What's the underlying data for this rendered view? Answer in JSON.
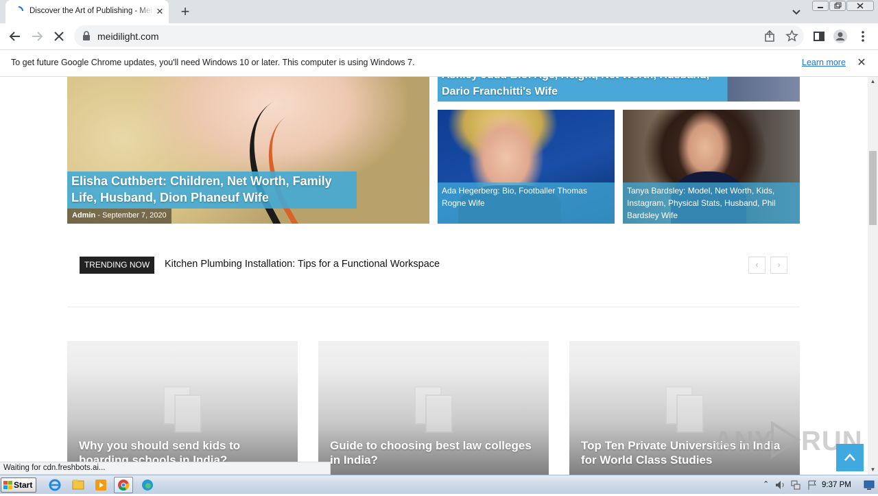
{
  "browser": {
    "tab_title": "Discover the Art of Publishing - Meidilight",
    "url": "meidilight.com",
    "infobar_message": "To get future Google Chrome updates, you'll need Windows 10 or later. This computer is using Windows 7.",
    "infobar_link": "Learn more",
    "status_text": "Waiting for cdn.freshbots.ai..."
  },
  "hero": {
    "main_title": "Elisha Cuthbert: Children, Net Worth, Family Life, Husband, Dion Phaneuf Wife",
    "main_author": "Admin",
    "main_separator": "-",
    "main_date": "September 7, 2020",
    "top_right_title": "Ashley Judd Bio: Age, Height, Net Worth, Husband, Dario Franchitti's Wife",
    "ada_title": "Ada Hegerberg: Bio, Footballer Thomas Rogne Wife",
    "tanya_title": "Tanya Bardsley: Model, Net Worth, Kids, Instagram, Physical Stats, Husband, Phil Bardsley Wife"
  },
  "trending": {
    "label": "TRENDING NOW",
    "headline": "Kitchen Plumbing Installation: Tips for a Functional Workspace"
  },
  "cards": [
    {
      "title": "Why you should send kids to boarding schools in India?"
    },
    {
      "title": "Guide to choosing best law colleges in India?"
    },
    {
      "title": "Top Ten Private Universities in India for World Class Studies"
    }
  ],
  "watermark": {
    "left": "ANY",
    "right": "RUN"
  },
  "taskbar": {
    "start_label": "Start",
    "clock": "9:37 PM"
  },
  "colors": {
    "caption_blue": "#40aad7",
    "scroll_top_blue": "#3fa9e0",
    "trending_label_bg": "#222222"
  }
}
